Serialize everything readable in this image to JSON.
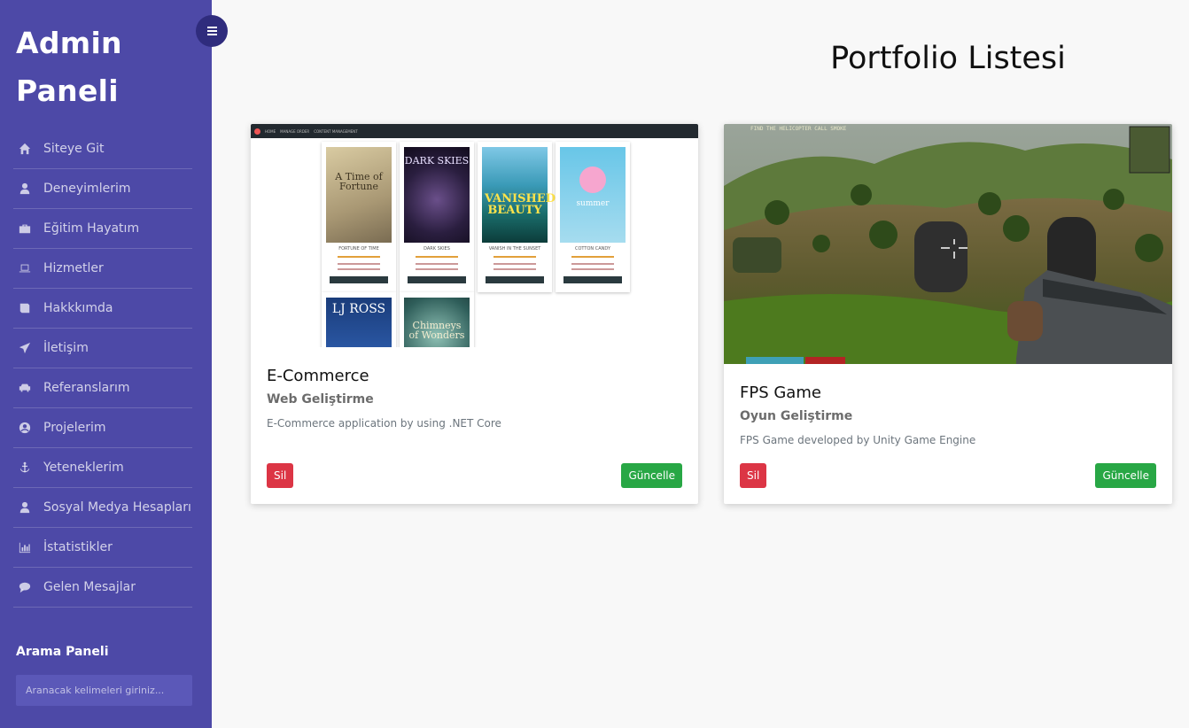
{
  "sidebar": {
    "brand": "Admin Paneli",
    "items": [
      {
        "label": "Siteye Git",
        "icon": "home-icon"
      },
      {
        "label": "Deneyimlerim",
        "icon": "user-icon"
      },
      {
        "label": "Eğitim Hayatım",
        "icon": "briefcase-icon"
      },
      {
        "label": "Hizmetler",
        "icon": "laptop-icon"
      },
      {
        "label": "Hakkkımda",
        "icon": "book-icon"
      },
      {
        "label": "İletişim",
        "icon": "paper-plane-icon"
      },
      {
        "label": "Referanslarım",
        "icon": "car-icon"
      },
      {
        "label": "Projelerim",
        "icon": "user-circle-icon"
      },
      {
        "label": "Yeteneklerim",
        "icon": "anchor-icon"
      },
      {
        "label": "Sosyal Medya Hesapları",
        "icon": "user-icon"
      },
      {
        "label": "İstatistikler",
        "icon": "bar-chart-icon"
      },
      {
        "label": "Gelen Mesajlar",
        "icon": "comment-icon"
      }
    ],
    "search_title": "Arama Paneli",
    "search_placeholder": "Aranacak kelimeleri giriniz..."
  },
  "toggle_icon": "menu-icon",
  "main": {
    "title": "Portfolio Listesi",
    "cards": [
      {
        "title": "E-Commerce",
        "subtitle": "Web Geliştirme",
        "description": "E-Commerce application by using .NET Core",
        "delete_label": "Sil",
        "update_label": "Güncelle",
        "image": {
          "books": [
            {
              "title": "FORTUNE OF TIME",
              "cover_text": "A Time of Fortune"
            },
            {
              "title": "DARK SKIES",
              "cover_text": "DARK SKIES"
            },
            {
              "title": "VANISH IN THE SUNSET",
              "cover_text": "VANISHED BEAUTY"
            },
            {
              "title": "COTTON CANDY",
              "cover_text": "summer"
            },
            {
              "title": "",
              "cover_text": "LJ ROSS"
            },
            {
              "title": "",
              "cover_text": "Chimneys of Wonders"
            }
          ]
        }
      },
      {
        "title": "FPS Game",
        "subtitle": "Oyun Geliştirme",
        "description": "FPS Game developed by Unity Game Engine",
        "delete_label": "Sil",
        "update_label": "Güncelle",
        "image": {
          "hud_text": "FIND THE HELICOPTER CALL SMOKE"
        }
      }
    ]
  },
  "colors": {
    "sidebar_bg": "#4d49a7",
    "toggle_bg": "#2f2c7d",
    "danger": "#dc3545",
    "success": "#28a745"
  }
}
